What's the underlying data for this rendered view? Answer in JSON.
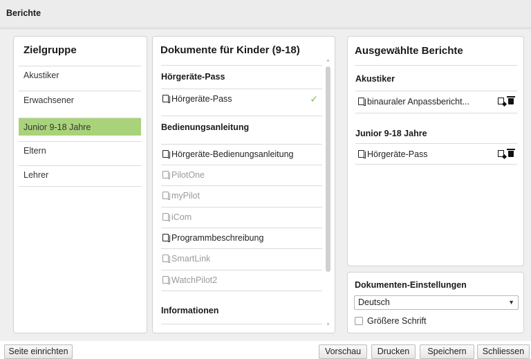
{
  "window": {
    "title": "Berichte"
  },
  "zielgruppe": {
    "title": "Zielgruppe",
    "items": [
      {
        "label": "Akustiker",
        "selected": false
      },
      {
        "label": "Erwachsener",
        "selected": false
      },
      {
        "label": "Junior 9-18 Jahre",
        "selected": true
      },
      {
        "label": "Eltern",
        "selected": false
      },
      {
        "label": "Lehrer",
        "selected": false
      }
    ]
  },
  "dokumente": {
    "title": "Dokumente für Kinder (9-18)",
    "sections": [
      {
        "heading": "Hörgeräte-Pass",
        "items": [
          {
            "label": "Hörgeräte-Pass",
            "enabled": true,
            "checked": true
          }
        ]
      },
      {
        "heading": "Bedienungsanleitung",
        "items": [
          {
            "label": "Hörgeräte-Bedienungsanleitung",
            "enabled": true,
            "checked": false
          },
          {
            "label": "PilotOne",
            "enabled": false,
            "checked": false
          },
          {
            "label": "myPilot",
            "enabled": false,
            "checked": false
          },
          {
            "label": "iCom",
            "enabled": false,
            "checked": false
          },
          {
            "label": "Programmbeschreibung",
            "enabled": true,
            "checked": false
          },
          {
            "label": "SmartLink",
            "enabled": false,
            "checked": false
          },
          {
            "label": "WatchPilot2",
            "enabled": false,
            "checked": false
          }
        ]
      },
      {
        "heading": "Informationen",
        "items": []
      }
    ],
    "check_glyph": "✓"
  },
  "ausgewaehlt": {
    "title": "Ausgewählte Berichte",
    "groups": [
      {
        "heading": "Akustiker",
        "items": [
          {
            "label": "binauraler Anpassbericht..."
          }
        ]
      },
      {
        "heading": "Junior 9-18 Jahre",
        "items": [
          {
            "label": "Hörgeräte-Pass"
          }
        ]
      }
    ]
  },
  "einstellungen": {
    "title": "Dokumenten-Einstellungen",
    "language": "Deutsch",
    "large_font_label": "Größere Schrift",
    "large_font_checked": false
  },
  "footer": {
    "page_setup": "Seite einrichten",
    "preview": "Vorschau",
    "print": "Drucken",
    "save": "Speichern",
    "close": "Schliessen"
  },
  "colors": {
    "selection": "#a9d37a",
    "check": "#7bbf4a",
    "disabled_text": "#9a9a9a"
  }
}
